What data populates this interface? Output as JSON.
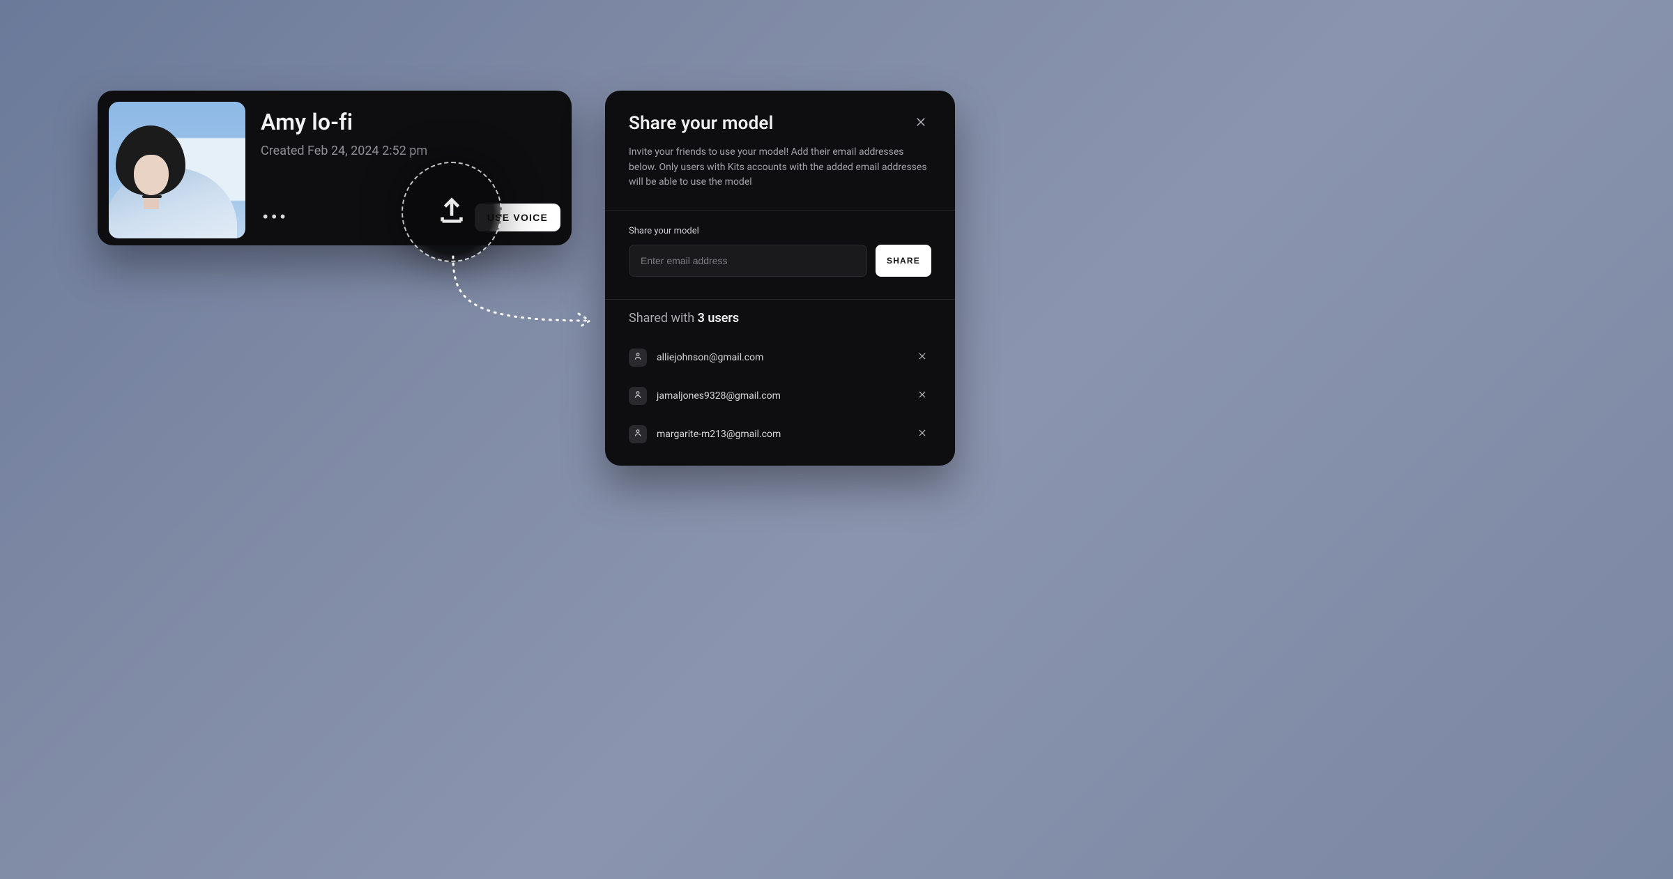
{
  "model_card": {
    "title": "Amy lo-fi",
    "created_label": "Created Feb 24, 2024 2:52 pm",
    "more_button_glyph": "•••",
    "use_voice_label": "USE VOICE",
    "thumb_alt": "model-cover-photo"
  },
  "share_bubble": {
    "icon_name": "upload-share-icon"
  },
  "share_modal": {
    "title": "Share your model",
    "description": "Invite your friends to use your model! Add their email addresses below. Only users with Kits accounts with the added email addresses will be able to use the model",
    "form": {
      "label": "Share your model",
      "placeholder": "Enter email address",
      "submit_label": "SHARE"
    },
    "shared_with": {
      "prefix": "Shared with ",
      "count_text": "3 users",
      "users": [
        {
          "email": "alliejohnson@gmail.com"
        },
        {
          "email": "jamaljones9328@gmail.com"
        },
        {
          "email": "margarite-m213@gmail.com"
        }
      ]
    }
  }
}
